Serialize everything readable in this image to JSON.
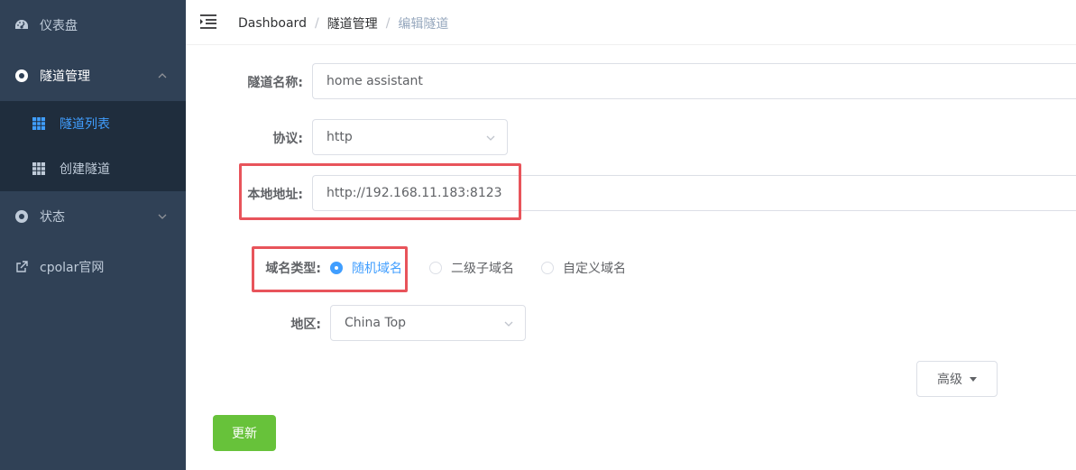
{
  "sidebar": {
    "dashboard": "仪表盘",
    "tunnels": "隧道管理",
    "tunnel_list": "隧道列表",
    "create_tunnel": "创建隧道",
    "status": "状态",
    "cpolar_site": "cpolar官网"
  },
  "breadcrumb": [
    "Dashboard",
    "隧道管理",
    "编辑隧道"
  ],
  "form": {
    "name_label": "隧道名称:",
    "name_value": "home assistant",
    "protocol_label": "协议:",
    "protocol_value": "http",
    "local_addr_label": "本地地址:",
    "local_addr_value": "http://192.168.11.183:8123",
    "domain_type_label": "域名类型:",
    "domain_options": [
      "随机域名",
      "二级子域名",
      "自定义域名"
    ],
    "domain_selected": "随机域名",
    "region_label": "地区:",
    "region_value": "China Top",
    "advanced_label": "高级",
    "update_label": "更新"
  },
  "colors": {
    "sidebar_bg": "#304156",
    "submenu_bg": "#1f2d3d",
    "active": "#409eff",
    "highlight": "#e8545b",
    "update_btn": "#67c23a"
  }
}
